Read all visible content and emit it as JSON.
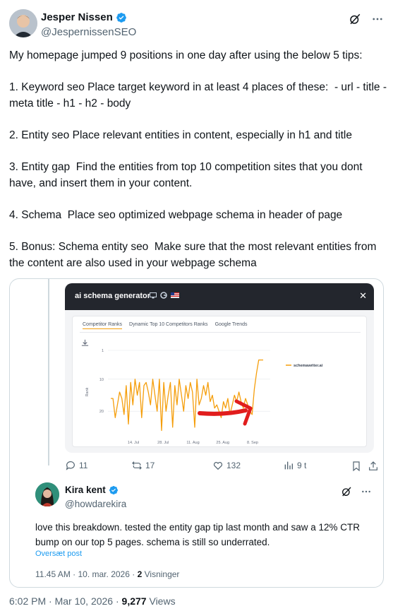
{
  "author": {
    "display_name": "Jesper Nissen",
    "handle": "@JespernissenSEO"
  },
  "tweet": {
    "paragraphs": [
      "My homepage jumped 9 positions in one day after using the below 5 tips:",
      "1. Keyword seo Place target keyword in at least 4 places of these:  - url - title - meta title - h1 - h2 - body",
      "2. Entity seo Place relevant entities in content, especially in h1 and title",
      "3. Entity gap  Find the entities from top 10 competition sites that you dont have, and insert them in your content.",
      "4. Schema  Place seo optimized webpage schema in header of page",
      "5. Bonus: Schema entity seo  Make sure that the most relevant entities from the content are also used in your webpage schema"
    ],
    "time": "6:02 PM",
    "date": "Mar 10, 2026",
    "views_count": "9,277",
    "views_label": "Views"
  },
  "embed": {
    "title": "ai schema generator",
    "tabs": [
      "Competitor Ranks",
      "Dynamic Top 10 Competitors Ranks",
      "Google Trends"
    ],
    "active_tab": 0
  },
  "chart_data": {
    "type": "line",
    "ylabel": "Rank",
    "y_ticks": [
      1,
      10,
      20
    ],
    "ylim": [
      1,
      27
    ],
    "y_inverted": true,
    "x_ticks": [
      "14. Jul",
      "28. Jul",
      "11. Aug",
      "25. Aug",
      "8. Sep"
    ],
    "legend_position": "top-right",
    "series": [
      {
        "name": "schemawriter.ai",
        "color": "#f59e0b",
        "values": [
          16,
          16,
          22,
          18,
          14,
          16,
          21,
          12,
          24,
          11,
          18,
          10,
          15,
          11,
          22,
          12,
          11,
          14,
          18,
          10,
          15,
          20,
          10,
          26,
          11,
          20,
          15,
          11,
          25,
          12,
          18,
          10,
          15,
          20,
          12,
          16,
          11,
          14,
          25,
          10,
          18,
          16,
          12,
          15,
          11,
          17,
          15,
          19,
          18,
          20,
          22,
          17,
          19,
          16,
          21,
          18,
          15,
          17,
          14,
          17,
          19,
          16,
          18,
          20,
          21,
          13,
          8,
          4,
          4,
          4
        ]
      }
    ]
  },
  "quote_actions": {
    "replies": "11",
    "reposts": "17",
    "likes": "132",
    "views": "9 t"
  },
  "reply": {
    "display_name": "Kira kent",
    "handle": "@howdarekira",
    "text": "love this breakdown. tested the entity gap tip last month and saw a 12% CTR bump on our top 5 pages. schema is still so underrated.",
    "translate_label": "Oversæt post",
    "time": "11.45 AM",
    "date": "10. mar. 2026",
    "views_count": "2",
    "views_label": "Visninger"
  },
  "colors": {
    "verified": "#1d9bf0",
    "accent_chart": "#f59e0b",
    "annotation_arrow": "#e11d1d",
    "text_secondary": "#536471",
    "border": "#cfd9de"
  },
  "icons": {
    "grok": "grok-icon",
    "more": "more-icon",
    "reply": "reply-icon",
    "repost": "repost-icon",
    "like": "like-icon",
    "views": "views-icon",
    "bookmark": "bookmark-icon",
    "share": "share-icon",
    "download": "download-icon",
    "close": "close-icon"
  }
}
